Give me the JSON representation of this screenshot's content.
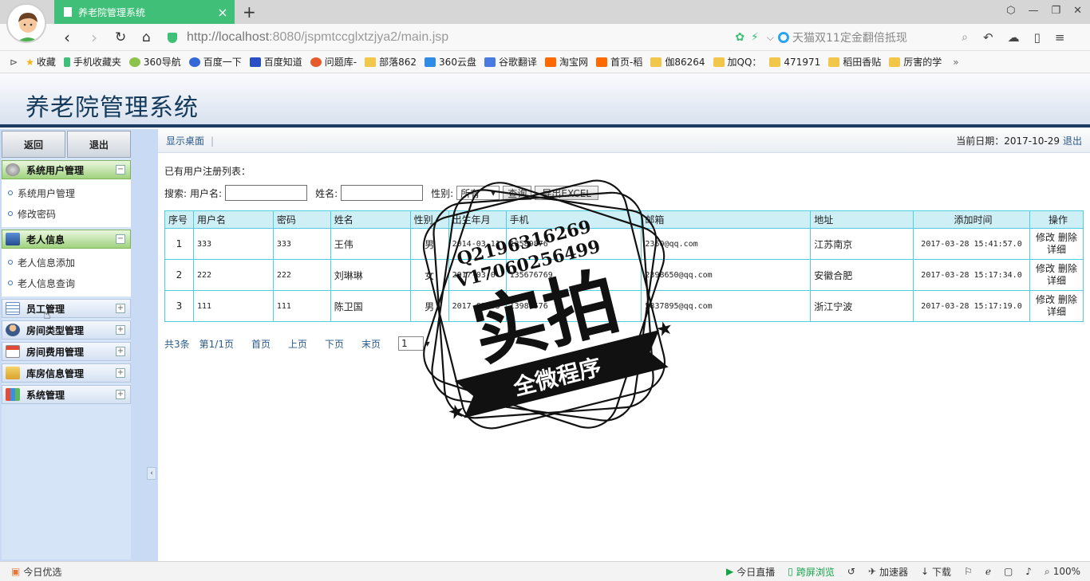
{
  "browser": {
    "tab_title": "养老院管理系统",
    "url_host": "http://localhost",
    "url_rest": ":8080/jspmtccglxtzjya2/main.jsp",
    "search_placeholder": "天猫双11定金翻倍抵现",
    "bookmarks": [
      "收藏",
      "手机收藏夹",
      "360导航",
      "百度一下",
      "百度知道",
      "问题库-",
      "部落862",
      "360云盘",
      "谷歌翻译",
      "淘宝网",
      "首页-稻",
      "伽86264",
      "加QQ：",
      "471971",
      "稻田香贴",
      "厉害的学"
    ]
  },
  "app": {
    "title": "养老院管理系统"
  },
  "sidebar": {
    "back_label": "返回",
    "exit_label": "退出",
    "groups": [
      {
        "label": "系统用户管理",
        "expanded": true,
        "items": [
          "系统用户管理",
          "修改密码"
        ]
      },
      {
        "label": "老人信息",
        "expanded": true,
        "items": [
          "老人信息添加",
          "老人信息查询"
        ]
      },
      {
        "label": "员工管理",
        "expanded": false
      },
      {
        "label": "房间类型管理",
        "expanded": false
      },
      {
        "label": "房间费用管理",
        "expanded": false
      },
      {
        "label": "库房信息管理",
        "expanded": false
      },
      {
        "label": "系统管理",
        "expanded": false
      }
    ]
  },
  "content": {
    "show_desktop": "显示桌面",
    "date_label": "当前日期：2017-10-29",
    "logout": "退出",
    "list_title": "已有用户注册列表：",
    "search": {
      "prefix": "搜索:",
      "username_label": "用户名:",
      "name_label": "姓名:",
      "gender_label": "性别:",
      "gender_value": "所有",
      "query_button": "查询",
      "export_button": "导出EXCEL"
    },
    "table": {
      "headers": [
        "序号",
        "用户名",
        "密码",
        "姓名",
        "性别",
        "出生年月",
        "手机",
        "邮箱",
        "地址",
        "添加时间",
        "操作"
      ],
      "rows": [
        [
          "1",
          "333",
          "333",
          "王伟",
          "男",
          "2014-03-11",
          "13589876",
          "2350@qq.com",
          "江苏南京",
          "2017-03-28 15:41:57.0"
        ],
        [
          "2",
          "222",
          "222",
          "刘琳琳",
          "女",
          "2017-03-0",
          "135676769",
          "2398650@qq.com",
          "安徽合肥",
          "2017-03-28 15:17:34.0"
        ],
        [
          "3",
          "111",
          "111",
          "陈卫国",
          "男",
          "2017-03-05",
          "13988576",
          "5837895@qq.com",
          "浙江宁波",
          "2017-03-28 15:17:19.0"
        ]
      ],
      "op_edit": "修改",
      "op_delete": "删除",
      "op_detail": "详细"
    },
    "pager": {
      "total": "共3条",
      "page": "第1/1页",
      "first": "首页",
      "prev": "上页",
      "next": "下页",
      "last": "末页",
      "select_value": "1"
    }
  },
  "watermark": {
    "line1": "Q2196316269",
    "line2": "V17060256499",
    "big": "实拍",
    "banner": "全微程序"
  },
  "statusbar": {
    "left": "今日优选",
    "live": "今日直播",
    "cross_screen": "跨屏浏览",
    "accelerator": "加速器",
    "download": "下载",
    "zoom": "100%"
  },
  "colors": {
    "tab_green": "#3fbf78",
    "header_navy": "#1f3c64",
    "table_border": "#4cd0e0",
    "link_blue": "#2a5a8a"
  }
}
